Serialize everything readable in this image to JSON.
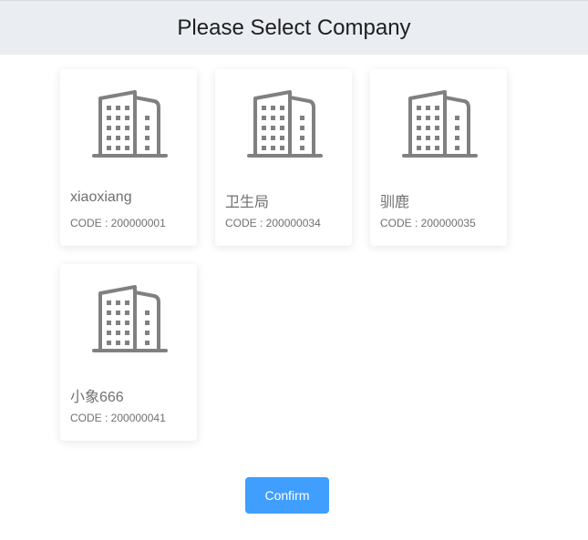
{
  "header": {
    "title": "Please Select Company"
  },
  "companies": [
    {
      "name": "xiaoxiang",
      "code": "CODE : 200000001",
      "icon": "building-icon"
    },
    {
      "name": "卫生局",
      "code": "CODE : 200000034",
      "icon": "building-icon"
    },
    {
      "name": "驯鹿",
      "code": "CODE : 200000035",
      "icon": "building-icon"
    },
    {
      "name": "小象666",
      "code": "CODE : 200000041",
      "icon": "building-icon"
    }
  ],
  "actions": {
    "confirm_label": "Confirm"
  },
  "colors": {
    "header_bg": "#eaedf2",
    "icon": "#808080",
    "text": "#707070",
    "primary": "#409eff"
  }
}
